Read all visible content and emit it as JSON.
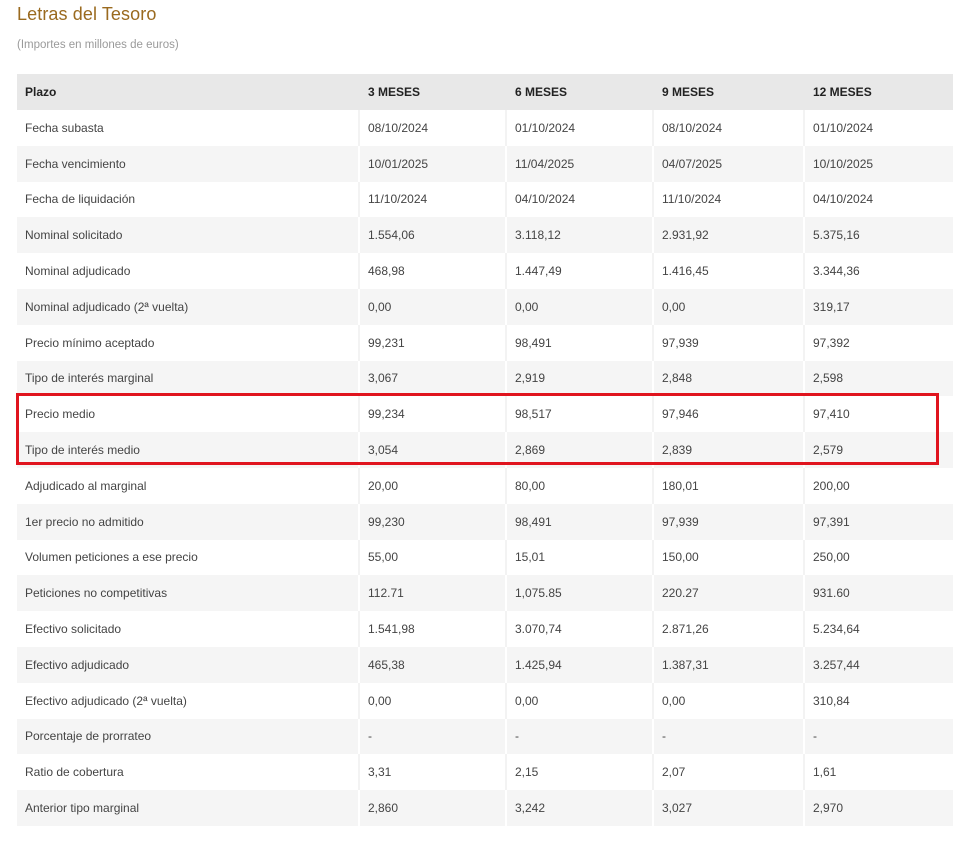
{
  "title": "Letras del Tesoro",
  "subtitle": "(Importes en millones de euros)",
  "table": {
    "headers": [
      "Plazo",
      "3 MESES",
      "6 MESES",
      "9 MESES",
      "12 MESES"
    ],
    "rows": [
      [
        "Fecha subasta",
        "08/10/2024",
        "01/10/2024",
        "08/10/2024",
        "01/10/2024"
      ],
      [
        "Fecha vencimiento",
        "10/01/2025",
        "11/04/2025",
        "04/07/2025",
        "10/10/2025"
      ],
      [
        "Fecha de liquidación",
        "11/10/2024",
        "04/10/2024",
        "11/10/2024",
        "04/10/2024"
      ],
      [
        "Nominal solicitado",
        "1.554,06",
        "3.118,12",
        "2.931,92",
        "5.375,16"
      ],
      [
        "Nominal adjudicado",
        "468,98",
        "1.447,49",
        "1.416,45",
        "3.344,36"
      ],
      [
        "Nominal adjudicado (2ª vuelta)",
        "0,00",
        "0,00",
        "0,00",
        "319,17"
      ],
      [
        "Precio mínimo aceptado",
        "99,231",
        "98,491",
        "97,939",
        "97,392"
      ],
      [
        "Tipo de interés marginal",
        "3,067",
        "2,919",
        "2,848",
        "2,598"
      ],
      [
        "Precio medio",
        "99,234",
        "98,517",
        "97,946",
        "97,410"
      ],
      [
        "Tipo de interés medio",
        "3,054",
        "2,869",
        "2,839",
        "2,579"
      ],
      [
        "Adjudicado al marginal",
        "20,00",
        "80,00",
        "180,01",
        "200,00"
      ],
      [
        "1er precio no admitido",
        "99,230",
        "98,491",
        "97,939",
        "97,391"
      ],
      [
        "Volumen peticiones a ese precio",
        "55,00",
        "15,01",
        "150,00",
        "250,00"
      ],
      [
        "Peticiones no competitivas",
        "112.71",
        "1,075.85",
        "220.27",
        "931.60"
      ],
      [
        "Efectivo solicitado",
        "1.541,98",
        "3.070,74",
        "2.871,26",
        "5.234,64"
      ],
      [
        "Efectivo adjudicado",
        "465,38",
        "1.425,94",
        "1.387,31",
        "3.257,44"
      ],
      [
        "Efectivo adjudicado (2ª vuelta)",
        "0,00",
        "0,00",
        "0,00",
        "310,84"
      ],
      [
        "Porcentaje de prorrateo",
        "-",
        "-",
        "-",
        "-"
      ],
      [
        "Ratio de cobertura",
        "3,31",
        "2,15",
        "2,07",
        "1,61"
      ],
      [
        "Anterior tipo marginal",
        "2,860",
        "3,242",
        "3,027",
        "2,970"
      ]
    ]
  },
  "colors": {
    "title": "#9a6a1f",
    "header_bg": "#e8e8e8",
    "stripe_bg": "#f5f5f5",
    "highlight_border": "#e0141e"
  }
}
